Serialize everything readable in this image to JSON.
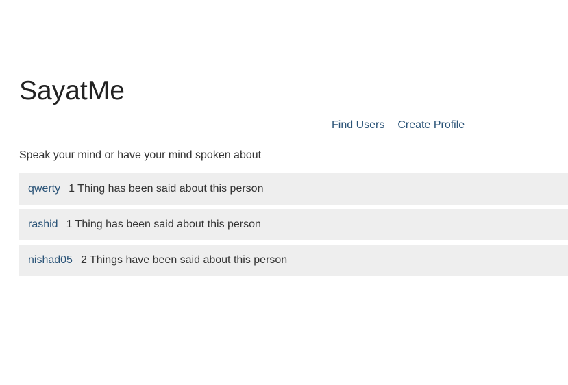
{
  "site": {
    "title": "SayatMe",
    "tagline": "Speak your mind or have your mind spoken about"
  },
  "nav": {
    "find_users": "Find Users",
    "create_profile": "Create Profile"
  },
  "users": [
    {
      "username": "qwerty",
      "summary": "1 Thing has been said about this person"
    },
    {
      "username": "rashid",
      "summary": "1 Thing has been said about this person"
    },
    {
      "username": "nishad05",
      "summary": "2 Things have been said about this person"
    }
  ],
  "colors": {
    "link": "#2a5377",
    "text": "#333333",
    "row_background": "#eeeeee"
  }
}
